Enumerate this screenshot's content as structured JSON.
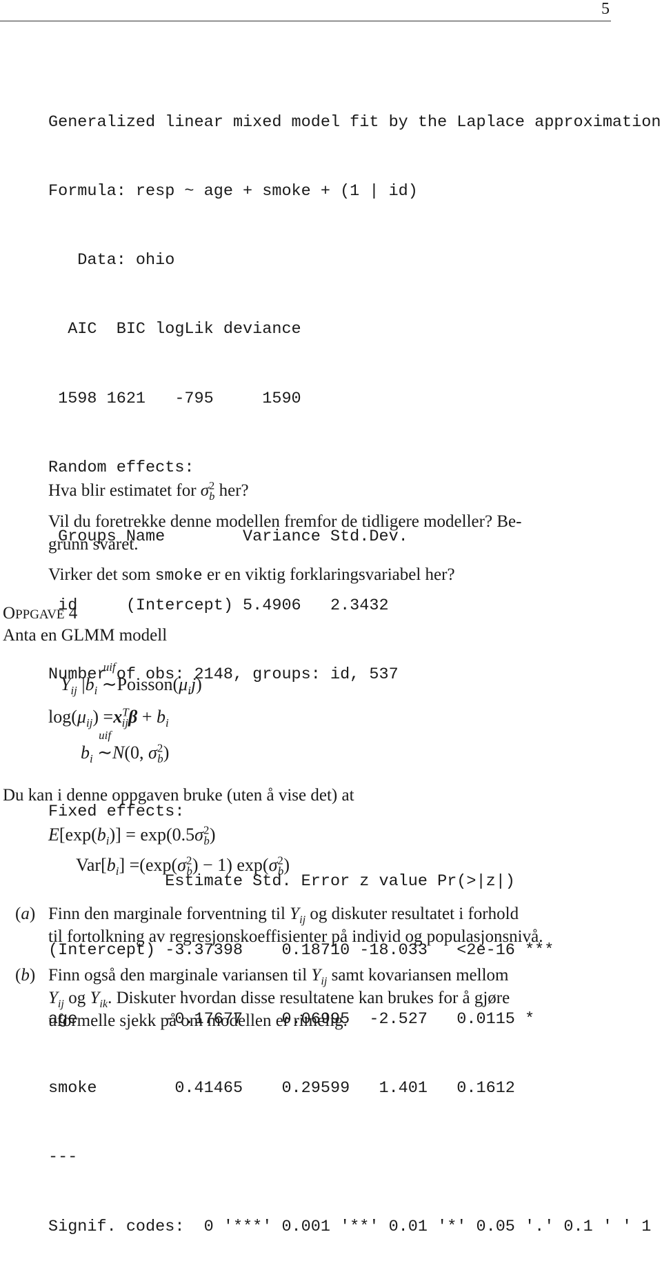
{
  "page_number": "5",
  "r_output": {
    "lines": [
      "Generalized linear mixed model fit by the Laplace approximation",
      "Formula: resp ~ age + smoke + (1 | id)",
      "   Data: ohio",
      "  AIC  BIC logLik deviance",
      " 1598 1621   -795     1590",
      "Random effects:",
      " Groups Name        Variance Std.Dev.",
      " id     (Intercept) 5.4906   2.3432",
      "Number of obs: 2148, groups: id, 537"
    ],
    "fixed_lines": [
      "Fixed effects:",
      "            Estimate Std. Error z value Pr(>|z|)",
      "(Intercept) -3.37398    0.18710 -18.033   <2e-16 ***",
      "age         -0.17677    0.06995  -2.527   0.0115 *",
      "smoke        0.41465    0.29599   1.401   0.1612",
      "---",
      "Signif. codes:  0 '***' 0.001 '**' 0.01 '*' 0.05 '.' 0.1 ' ' 1"
    ],
    "model_info": {
      "formula": "resp ~ age + smoke + (1 | id)",
      "data": "ohio",
      "AIC": 1598,
      "BIC": 1621,
      "logLik": -795,
      "deviance": 1590,
      "random_effects": [
        {
          "group": "id",
          "name": "(Intercept)",
          "variance": 5.4906,
          "std_dev": 2.3432
        }
      ],
      "n_obs": 2148,
      "n_groups": 537,
      "fixed_effects": [
        {
          "term": "(Intercept)",
          "estimate": -3.37398,
          "std_error": 0.1871,
          "z_value": -18.033,
          "p": "<2e-16",
          "signif": "***"
        },
        {
          "term": "age",
          "estimate": -0.17677,
          "std_error": 0.06995,
          "z_value": -2.527,
          "p": "0.0115",
          "signif": "*"
        },
        {
          "term": "smoke",
          "estimate": 0.41465,
          "std_error": 0.29599,
          "z_value": 1.401,
          "p": "0.1612",
          "signif": ""
        }
      ]
    }
  },
  "questions": {
    "q1_pre": "Hva blir estimatet for ",
    "q1_post": " her?",
    "q2_line1": "Vil du foretrekke denne modellen fremfor de tidligere modeller?  Be-",
    "q2_line2": "grunn svaret.",
    "q3_pre": "Virker det som ",
    "q3_code": "smoke",
    "q3_post": " er en viktig forklaringsvariabel her?"
  },
  "section": {
    "title_first": "O",
    "title_rest": "PPGAVE",
    "title_num": " 4",
    "intro": "Anta en GLMM modell"
  },
  "model_equations": {
    "eq1": "Y_ij | b_i ~uif Poisson(μ_i j)",
    "eq2": "log(μ_ij) = x_ij^T β + b_i",
    "eq3": "b_i ~uif N(0, σ_b^2)",
    "over_label": "uif",
    "poisson": "Poisson",
    "log": "log"
  },
  "hint_text": "Du kan i denne oppgaven bruke (uten å vise det) at",
  "hint_equations": {
    "expectation": "E[exp(b_i)] = exp(0.5σ_b^2)",
    "variance": "Var[b_i] = (exp(σ_b^2) − 1) exp(σ_b^2)"
  },
  "items": [
    {
      "label": "(a)",
      "lines": [
        "Finn den marginale forventning til Y_ij og diskuter resultatet i forhold",
        "til fortolkning av regresjonskoeffisienter på individ og populasjonsnivå."
      ],
      "a1": "Finn den marginale forventning til ",
      "a2": " og diskuter resultatet i forhold",
      "a3": "til fortolkning av regresjonskoeffisienter på individ og populasjonsnivå."
    },
    {
      "label": "(b)",
      "lines": [
        "Finn også den marginale variansen til Y_ij samt kovariansen mellom",
        "Y_ij og Y_ik. Diskuter hvordan disse resultatene kan brukes for å gjøre",
        "uformelle sjekk på om modellen er rimelig."
      ],
      "b1": "Finn også den marginale variansen til ",
      "b2": " samt kovariansen mellom",
      "b3": " og ",
      "b4": ". Diskuter hvordan disse resultatene kan brukes for å gjøre",
      "b5": "uformelle sjekk på om modellen er rimelig."
    }
  ]
}
